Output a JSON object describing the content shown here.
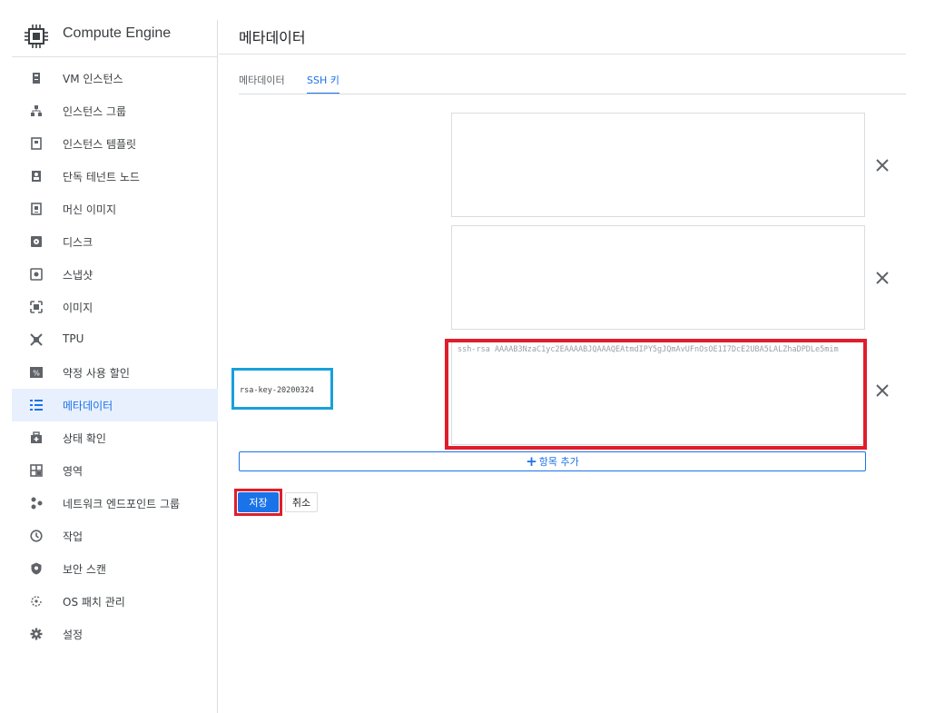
{
  "sidebar": {
    "product_title": "Compute Engine",
    "items": [
      {
        "label": "VM 인스턴스",
        "icon": "vm-instance-icon"
      },
      {
        "label": "인스턴스 그룹",
        "icon": "instance-group-icon"
      },
      {
        "label": "인스턴스 템플릿",
        "icon": "instance-template-icon"
      },
      {
        "label": "단독 테넌트 노드",
        "icon": "sole-tenant-node-icon"
      },
      {
        "label": "머신 이미지",
        "icon": "machine-image-icon"
      },
      {
        "label": "디스크",
        "icon": "disk-icon"
      },
      {
        "label": "스냅샷",
        "icon": "snapshot-icon"
      },
      {
        "label": "이미지",
        "icon": "image-icon"
      },
      {
        "label": "TPU",
        "icon": "tpu-icon"
      },
      {
        "label": "약정 사용 할인",
        "icon": "commitment-discount-icon"
      },
      {
        "label": "메타데이터",
        "icon": "metadata-icon",
        "active": true
      },
      {
        "label": "상태 확인",
        "icon": "health-check-icon"
      },
      {
        "label": "영역",
        "icon": "zone-icon"
      },
      {
        "label": "네트워크 엔드포인트 그룹",
        "icon": "network-endpoint-group-icon"
      },
      {
        "label": "작업",
        "icon": "operations-icon"
      },
      {
        "label": "보안 스캔",
        "icon": "security-scan-icon"
      },
      {
        "label": "OS 패치 관리",
        "icon": "os-patch-icon"
      },
      {
        "label": "설정",
        "icon": "settings-icon"
      }
    ]
  },
  "main": {
    "page_title": "메타데이터",
    "tabs": [
      {
        "label": "메타데이터",
        "active": false
      },
      {
        "label": "SSH 키",
        "active": true
      }
    ],
    "ssh_keys": [
      {
        "value": "",
        "username": ""
      },
      {
        "value": "",
        "username": ""
      },
      {
        "value": "ssh-rsa AAAAB3NzaC1yc2EAAAABJQAAAQEAtmdIPY5gJQmAvUFnOsOE1I7DcE2UBA5LALZhaDPDLe5mim",
        "username": "rsa-key-20200324"
      }
    ],
    "add_item_label": "항목 추가",
    "save_label": "저장",
    "cancel_label": "취소"
  },
  "colors": {
    "accent": "#1a73e8",
    "highlight_red": "#e01e2b",
    "highlight_blue": "#18a0db",
    "active_bg": "#e8f0fe"
  }
}
